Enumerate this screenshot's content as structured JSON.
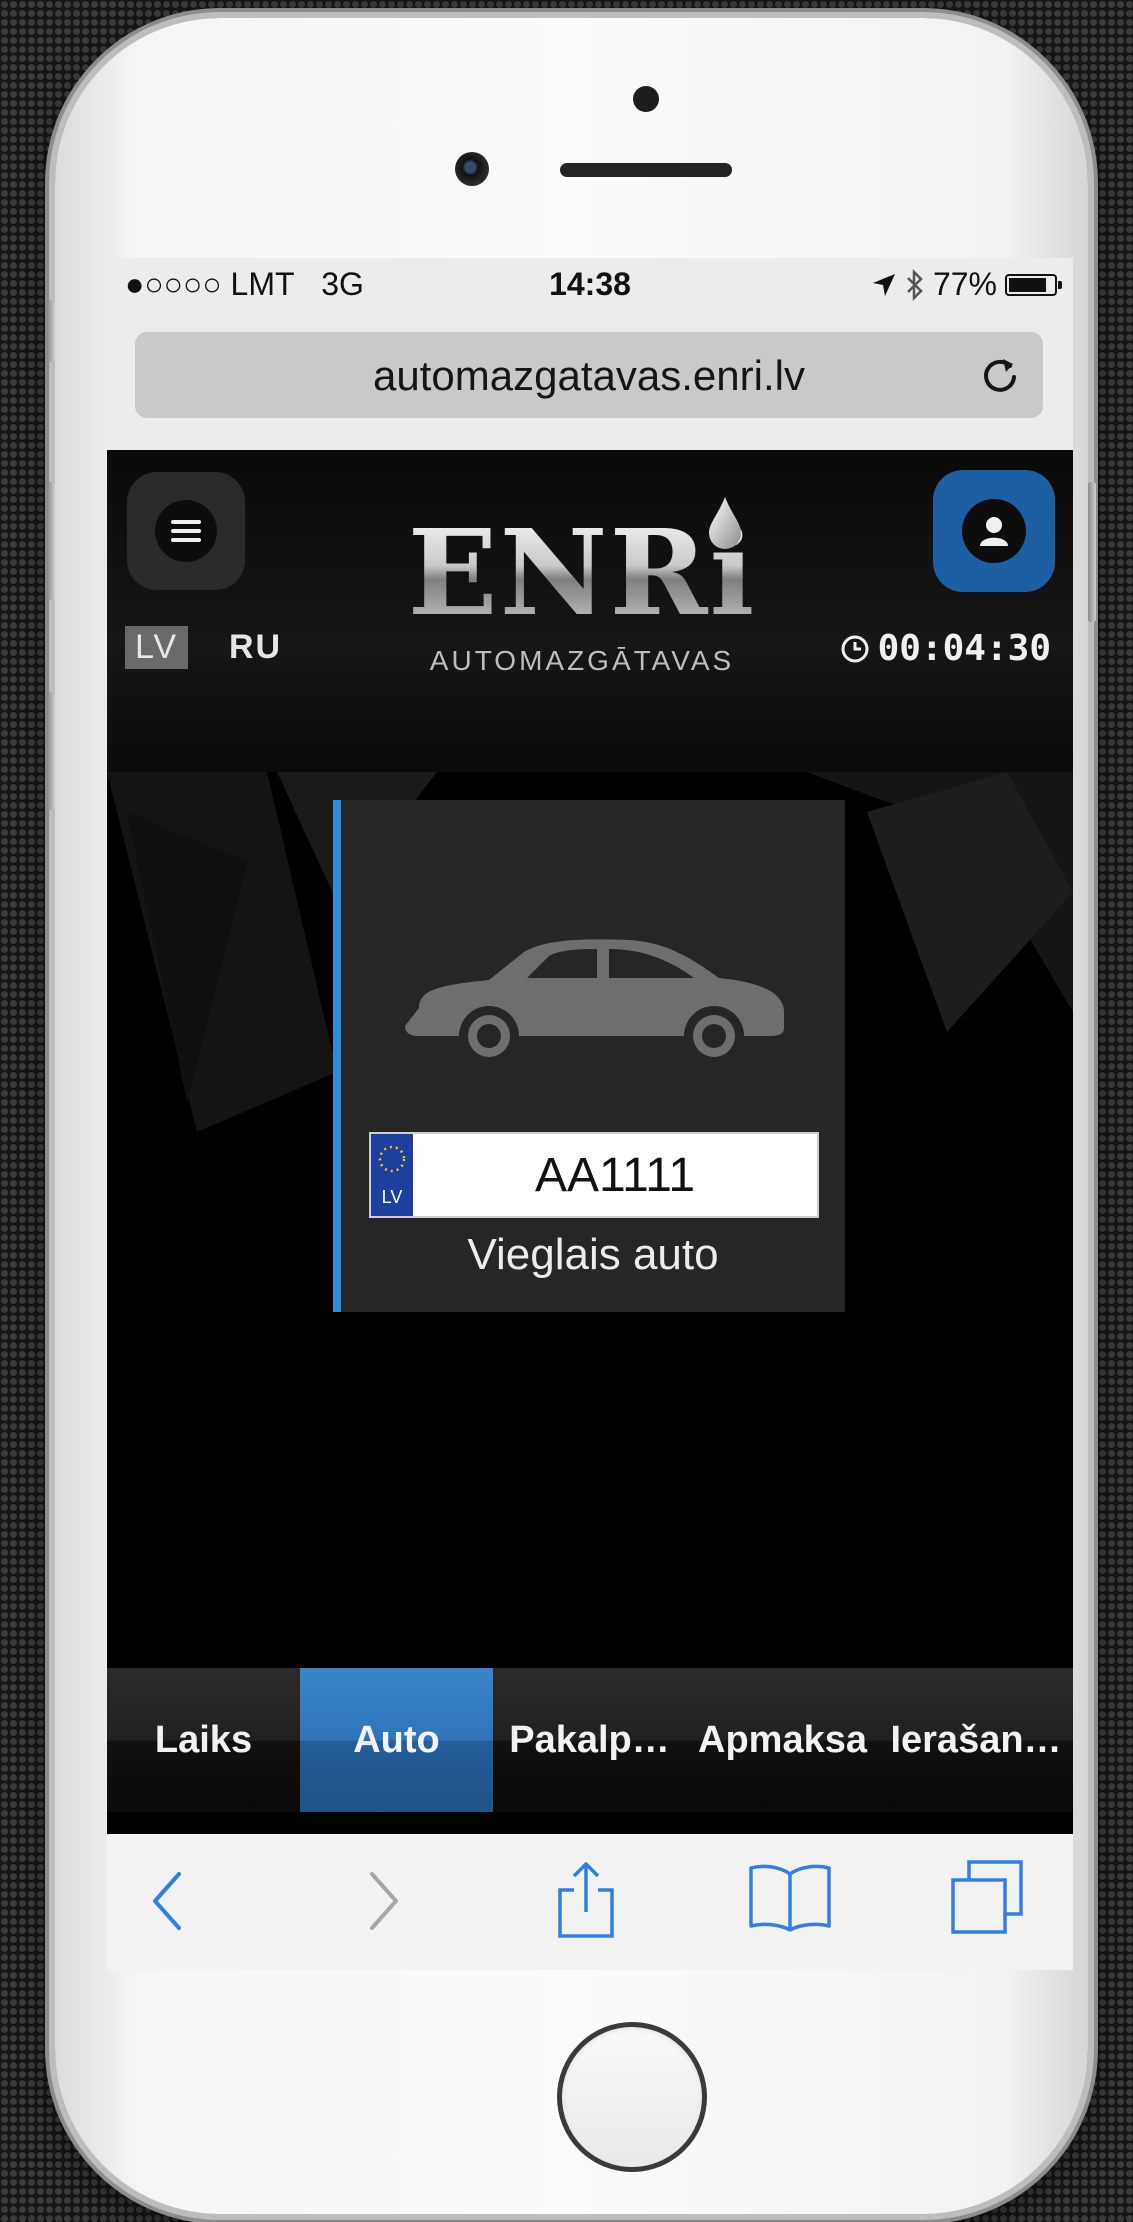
{
  "status_bar": {
    "carrier": "●○○○○ LMT",
    "network": "3G",
    "time": "14:38",
    "battery": "77%",
    "icons": [
      "location-icon",
      "bluetooth-icon",
      "battery-icon"
    ]
  },
  "browser": {
    "url": "automazgatavas.enri.lv",
    "reload_icon": "reload-icon",
    "toolbar_icons": [
      "back-icon",
      "forward-icon",
      "share-icon",
      "bookmarks-icon",
      "tabs-icon"
    ]
  },
  "header": {
    "logo_text": "ENRi",
    "logo_subtitle": "AUTOMAZGĀTAVAS",
    "menu_icon": "hamburger-icon",
    "account_icon": "user-icon",
    "languages": [
      {
        "label": "LV",
        "selected": true
      },
      {
        "label": "RU",
        "selected": false
      }
    ],
    "timer_icon": "clock-icon",
    "timer": "00:04:30"
  },
  "vehicle": {
    "icon": "car-icon",
    "plate_country": "LV",
    "plate_number": "AA1111",
    "type": "Vieglais auto"
  },
  "steps": [
    {
      "label": "Laiks",
      "active": false
    },
    {
      "label": "Auto",
      "active": true
    },
    {
      "label": "Pakalp…",
      "active": false
    },
    {
      "label": "Apmaksa",
      "active": false
    },
    {
      "label": "Ierašan…",
      "active": false
    }
  ],
  "colors": {
    "accent": "#2a8ee0",
    "active_tab": "#2f74b9",
    "account_button": "#1c5fa3",
    "ios_tint": "#2f7fe6"
  }
}
